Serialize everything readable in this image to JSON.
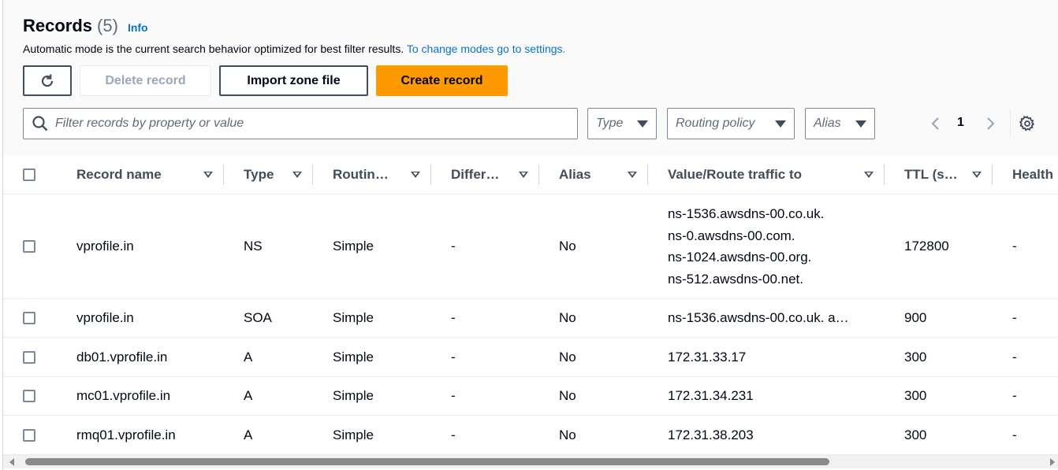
{
  "header": {
    "title": "Records",
    "count": "(5)",
    "info_link": "Info",
    "description": "Automatic mode is the current search behavior optimized for best filter results.",
    "description_link": "To change modes go to settings."
  },
  "toolbar": {
    "refresh_icon": "refresh-icon",
    "delete_label": "Delete record",
    "import_label": "Import zone file",
    "create_label": "Create record"
  },
  "filters": {
    "search_placeholder": "Filter records by property or value",
    "type_label": "Type",
    "routing_label": "Routing policy",
    "alias_label": "Alias"
  },
  "pagination": {
    "current_page": "1"
  },
  "table": {
    "columns": [
      "Record name",
      "Type",
      "Routin…",
      "Differ…",
      "Alias",
      "Value/Route traffic to",
      "TTL (s…",
      "Health"
    ],
    "rows": [
      {
        "name": "vprofile.in",
        "type": "NS",
        "routing": "Simple",
        "differ": "-",
        "alias": "No",
        "values": [
          "ns-1536.awsdns-00.co.uk.",
          "ns-0.awsdns-00.com.",
          "ns-1024.awsdns-00.org.",
          "ns-512.awsdns-00.net."
        ],
        "ttl": "172800",
        "health": "-"
      },
      {
        "name": "vprofile.in",
        "type": "SOA",
        "routing": "Simple",
        "differ": "-",
        "alias": "No",
        "values": [
          "ns-1536.awsdns-00.co.uk. a…"
        ],
        "ttl": "900",
        "health": "-"
      },
      {
        "name": "db01.vprofile.in",
        "type": "A",
        "routing": "Simple",
        "differ": "-",
        "alias": "No",
        "values": [
          "172.31.33.17"
        ],
        "ttl": "300",
        "health": "-"
      },
      {
        "name": "mc01.vprofile.in",
        "type": "A",
        "routing": "Simple",
        "differ": "-",
        "alias": "No",
        "values": [
          "172.31.34.231"
        ],
        "ttl": "300",
        "health": "-"
      },
      {
        "name": "rmq01.vprofile.in",
        "type": "A",
        "routing": "Simple",
        "differ": "-",
        "alias": "No",
        "values": [
          "172.31.38.203"
        ],
        "ttl": "300",
        "health": "-"
      }
    ]
  },
  "colors": {
    "primary": "#ff9900",
    "link": "#0972d3",
    "text": "#000716"
  }
}
